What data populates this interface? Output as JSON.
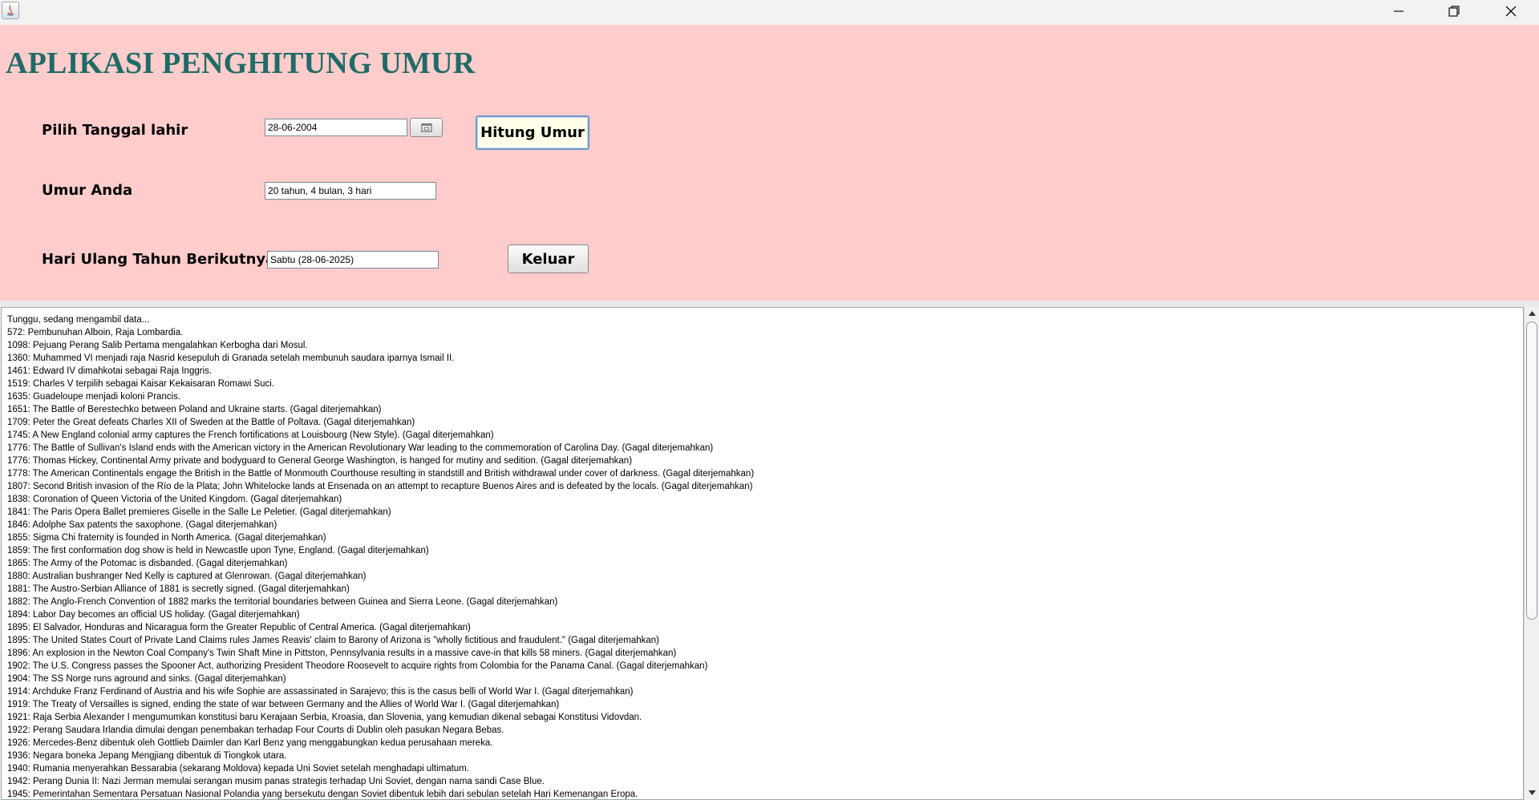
{
  "window": {
    "app_icon": "java-icon",
    "controls": {
      "minimize": "minimize-icon",
      "maximize": "restore-icon",
      "close": "close-icon"
    }
  },
  "form": {
    "title": "APLIKASI PENGHITUNG UMUR",
    "birth_label": "Pilih Tanggal lahir",
    "birth_value": "28-06-2004",
    "calendar_icon": "calendar-icon",
    "hitung_label": "Hitung Umur",
    "age_label": "Umur Anda",
    "age_value": "20 tahun, 4 bulan, 3 hari",
    "next_birthday_label": "Hari Ulang Tahun Berikutnya",
    "next_birthday_value": "Sabtu (28-06-2025)",
    "keluar_label": "Keluar"
  },
  "colors": {
    "panel_bg": "#ffcccc",
    "title": "#1f6b66",
    "hitung_bg": "#fffee8",
    "hitung_border": "#6d98c9"
  },
  "log_lines": [
    "Tunggu, sedang mengambil data...",
    "572: Pembunuhan Alboin, Raja Lombardia.",
    "1098: Pejuang Perang Salib Pertama mengalahkan Kerbogha dari Mosul.",
    "1360: Muhammed VI menjadi raja Nasrid kesepuluh di Granada setelah membunuh saudara iparnya Ismail II.",
    "1461: Edward IV dimahkotai sebagai Raja Inggris.",
    "1519: Charles V terpilih sebagai Kaisar Kekaisaran Romawi Suci.",
    "1635: Guadeloupe menjadi koloni Prancis.",
    "1651: The Battle of Berestechko between Poland and Ukraine starts. (Gagal diterjemahkan)",
    "1709: Peter the Great defeats Charles XII of Sweden at the Battle of Poltava. (Gagal diterjemahkan)",
    "1745: A New England colonial army captures the French fortifications at Louisbourg (New Style). (Gagal diterjemahkan)",
    "1776: The Battle of Sullivan's Island ends with the American victory in the American Revolutionary War leading to the commemoration of Carolina Day. (Gagal diterjemahkan)",
    "1776: Thomas Hickey, Continental Army private and bodyguard to General George Washington, is hanged for mutiny and sedition. (Gagal diterjemahkan)",
    "1778: The American Continentals engage the British in the Battle of Monmouth Courthouse resulting in standstill and British withdrawal under cover of darkness. (Gagal diterjemahkan)",
    "1807: Second British invasion of the Río de la Plata; John Whitelocke lands at Ensenada on an attempt to recapture Buenos Aires and is defeated by the locals. (Gagal diterjemahkan)",
    "1838: Coronation of Queen Victoria of the United Kingdom. (Gagal diterjemahkan)",
    "1841: The Paris Opera Ballet premieres Giselle in the Salle Le Peletier. (Gagal diterjemahkan)",
    "1846: Adolphe Sax patents the saxophone. (Gagal diterjemahkan)",
    "1855: Sigma Chi fraternity is founded in North America. (Gagal diterjemahkan)",
    "1859: The first conformation dog show is held in Newcastle upon Tyne, England. (Gagal diterjemahkan)",
    "1865: The Army of the Potomac is disbanded. (Gagal diterjemahkan)",
    "1880: Australian bushranger Ned Kelly is captured at Glenrowan. (Gagal diterjemahkan)",
    "1881: The Austro-Serbian Alliance of 1881 is secretly signed. (Gagal diterjemahkan)",
    "1882: The Anglo-French Convention of 1882 marks the territorial boundaries between Guinea and Sierra Leone. (Gagal diterjemahkan)",
    "1894: Labor Day becomes an official US holiday. (Gagal diterjemahkan)",
    "1895: El Salvador, Honduras and Nicaragua form the Greater Republic of Central America. (Gagal diterjemahkan)",
    "1895: The United States Court of Private Land Claims rules James Reavis' claim to Barony of Arizona is \"wholly fictitious and fraudulent.\" (Gagal diterjemahkan)",
    "1896: An explosion in the Newton Coal Company's Twin Shaft Mine in Pittston, Pennsylvania results in a massive cave-in that kills 58 miners. (Gagal diterjemahkan)",
    "1902: The U.S. Congress passes the Spooner Act, authorizing President Theodore Roosevelt to acquire rights from Colombia for the Panama Canal. (Gagal diterjemahkan)",
    "1904: The SS Norge runs aground and sinks. (Gagal diterjemahkan)",
    "1914: Archduke Franz Ferdinand of Austria and his wife Sophie are assassinated in Sarajevo; this is the casus belli of World War I. (Gagal diterjemahkan)",
    "1919: The Treaty of Versailles is signed, ending the state of war between Germany and the Allies of World War I. (Gagal diterjemahkan)",
    "1921: Raja Serbia Alexander I mengumumkan konstitusi baru Kerajaan Serbia, Kroasia, dan Slovenia, yang kemudian dikenal sebagai Konstitusi Vidovdan.",
    "1922: Perang Saudara Irlandia dimulai dengan penembakan terhadap Four Courts di Dublin oleh pasukan Negara Bebas.",
    "1926: Mercedes-Benz dibentuk oleh Gottlieb Daimler dan Karl Benz yang menggabungkan kedua perusahaan mereka.",
    "1936: Negara boneka Jepang Mengjiang dibentuk di Tiongkok utara.",
    "1940: Rumania menyerahkan Bessarabia (sekarang Moldova) kepada Uni Soviet setelah menghadapi ultimatum.",
    "1942: Perang Dunia II: Nazi Jerman memulai serangan musim panas strategis terhadap Uni Soviet, dengan nama sandi Case Blue.",
    "1945: Pemerintahan Sementara Persatuan Nasional Polandia yang bersekutu dengan Soviet dibentuk lebih dari sebulan setelah Hari Kemenangan Eropa."
  ]
}
